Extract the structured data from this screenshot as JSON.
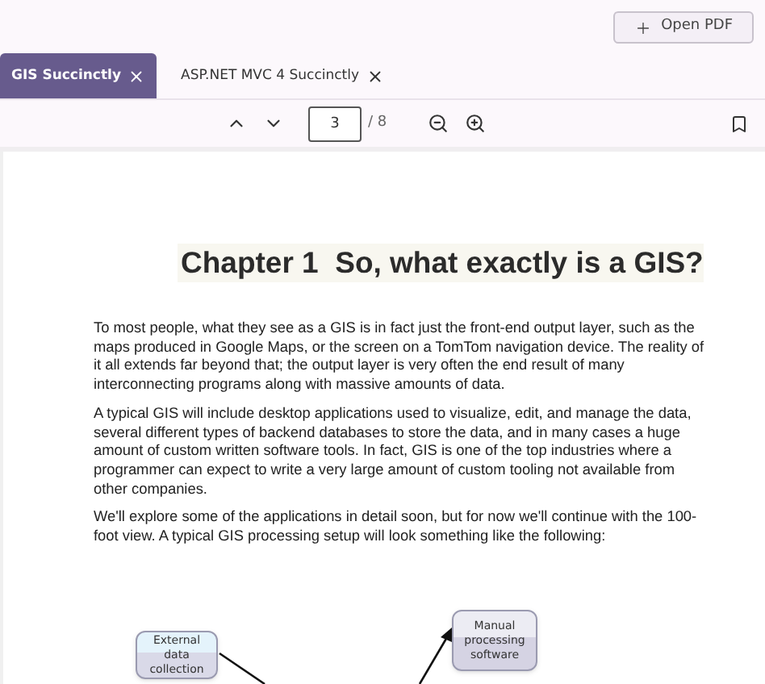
{
  "header": {
    "open_button": "Open PDF"
  },
  "tabs": [
    {
      "label": "GIS Succinctly",
      "selected": true
    },
    {
      "label": "ASP.NET MVC 4 Succinctly",
      "selected": false
    }
  ],
  "toolbar": {
    "page_input": {
      "value": "3"
    },
    "page_total": "/ 8"
  },
  "document": {
    "title": "Chapter 1  So, what exactly is a GIS?",
    "paragraphs": [
      "To most people, what they see as a GIS is in fact just the front-end output layer, such as the maps produced in Google Maps, or the screen on a TomTom navigation device. The reality of it all extends far beyond that; the output layer is very often the end result of many interconnecting programs along with massive amounts of data.",
      "A typical GIS will include desktop applications used to visualize, edit, and manage the data, several different types of backend databases to store the data, and in many cases a huge amount of custom written software tools. In fact, GIS is one of the top industries where a programmer can expect to write a very large amount of custom tooling not available from other companies.",
      "We'll explore some of the applications in detail soon, but for now we'll continue with the 100-foot view. A typical GIS processing setup will look something like the following:"
    ],
    "diagram": {
      "nodes": [
        {
          "label": "External data collection",
          "kind": "source"
        },
        {
          "label": "Manual processing software",
          "kind": "process"
        }
      ]
    }
  }
}
